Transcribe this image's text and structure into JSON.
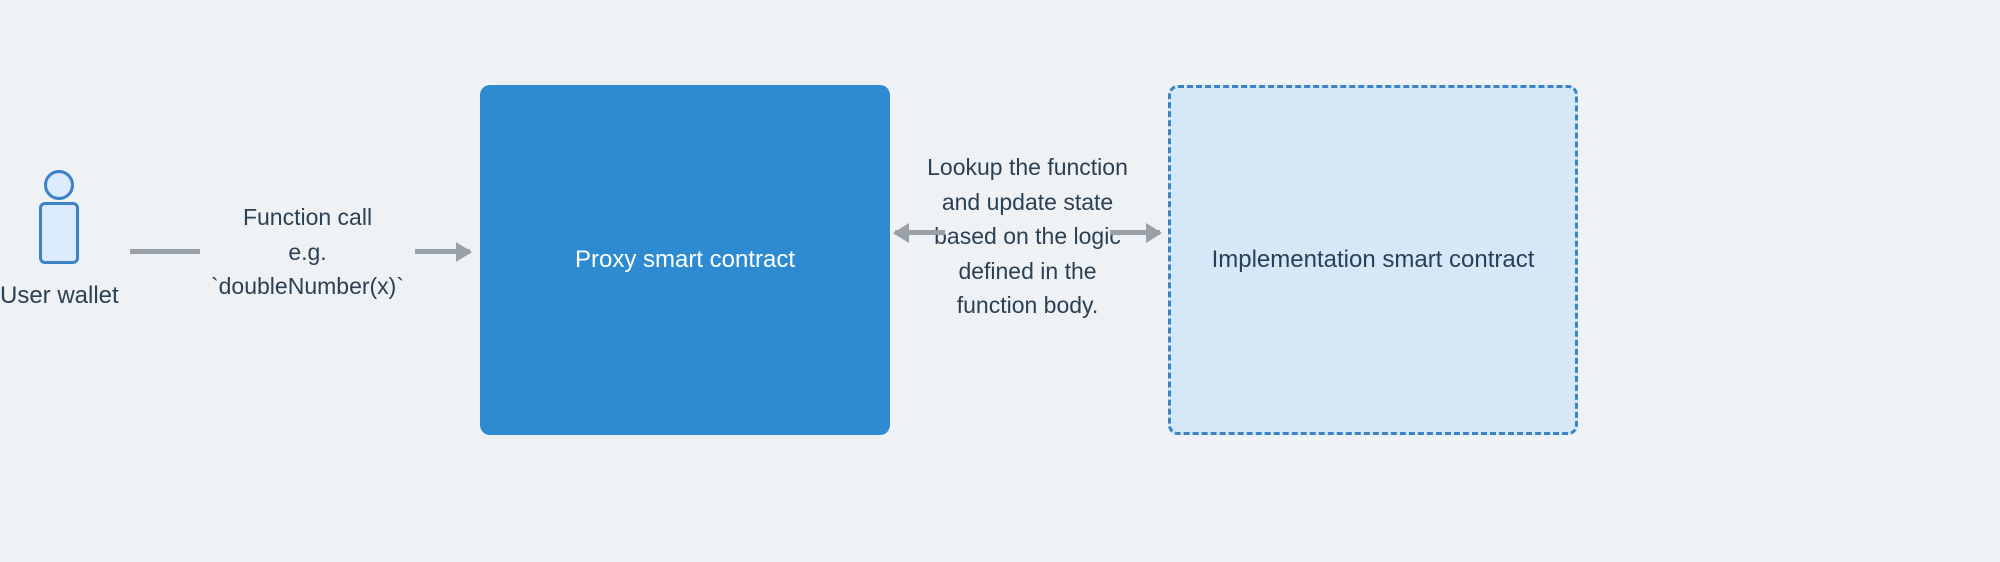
{
  "diagram": {
    "user_wallet_label": "User wallet",
    "arrow1_label_line1": "Function call",
    "arrow1_label_line2": "e.g.",
    "arrow1_label_line3": "`doubleNumber(x)`",
    "proxy_box_label": "Proxy smart contract",
    "arrow2_label_line1": "Lookup the function",
    "arrow2_label_line2": "and update state",
    "arrow2_label_line3": "based on the logic",
    "arrow2_label_line4": "defined in the",
    "arrow2_label_line5": "function body.",
    "impl_box_label": "Implementation smart contract"
  }
}
